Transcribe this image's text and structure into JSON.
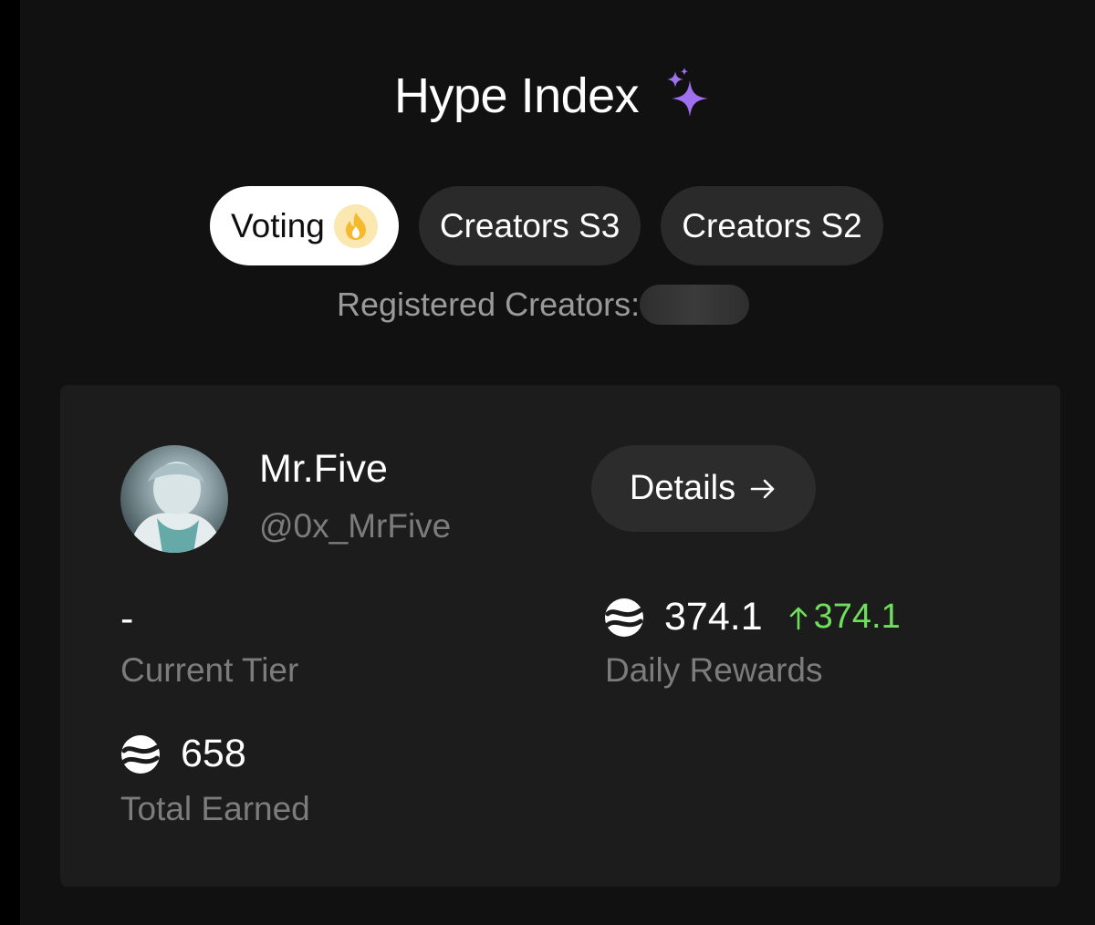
{
  "header": {
    "title": "Hype Index",
    "sparkle_icon": "sparkles-icon",
    "accent_color": "#a070f0"
  },
  "tabs": [
    {
      "label": "Voting",
      "active": true,
      "icon": "flame-icon"
    },
    {
      "label": "Creators S3",
      "active": false
    },
    {
      "label": "Creators S2",
      "active": false
    }
  ],
  "registered": {
    "label": "Registered Creators:"
  },
  "profile": {
    "name": "Mr.Five",
    "handle": "@0x_MrFive",
    "details_label": "Details",
    "details_icon": "arrow-right-icon"
  },
  "stats": {
    "current_tier": {
      "value": "-",
      "label": "Current Tier"
    },
    "daily_rewards": {
      "value": "374.1",
      "change": "374.1",
      "label": "Daily Rewards",
      "icon": "token-icon",
      "change_color": "#6ee05c"
    },
    "total_earned": {
      "value": "658",
      "label": "Total Earned",
      "icon": "token-icon"
    }
  }
}
